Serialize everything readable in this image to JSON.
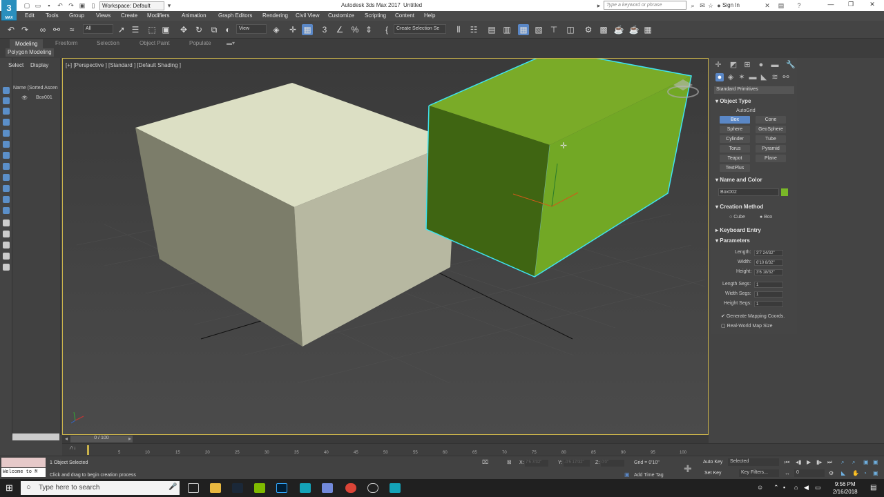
{
  "titlebar": {
    "workspace": "Workspace: Default",
    "app_title": "Autodesk 3ds Max 2017",
    "doc_title": "Untitled",
    "search_placeholder": "Type a keyword or phrase",
    "signin": "Sign In",
    "logo": "3",
    "logo_sub": "MAX"
  },
  "menu": [
    "Edit",
    "Tools",
    "Group",
    "Views",
    "Create",
    "Modifiers",
    "Animation",
    "Graph Editors",
    "Rendering",
    "Civil View",
    "Customize",
    "Scripting",
    "Content",
    "Help"
  ],
  "toolbar": {
    "filter": "All",
    "view": "View",
    "selection_set": "Create Selection Se"
  },
  "ribbon": {
    "tabs": [
      "Modeling",
      "Freeform",
      "Selection",
      "Object Paint",
      "Populate"
    ],
    "polygon_modeling": "Polygon Modeling"
  },
  "scene_explorer": {
    "tab_select": "Select",
    "tab_display": "Display",
    "header": "Name (Sorted Ascen",
    "object": "Box001"
  },
  "viewport": {
    "label": "[+] [Perspective ] [Standard ] [Default Shading ]",
    "box1_color": "#dcdfc4",
    "box2_color": "#7aab28",
    "selection_color": "#3fe3f0"
  },
  "command_panel": {
    "dropdown": "Standard Primitives",
    "object_type": {
      "title": "Object Type",
      "autogrid": "AutoGrid",
      "buttons": [
        "Box",
        "Cone",
        "Sphere",
        "GeoSphere",
        "Cylinder",
        "Tube",
        "Torus",
        "Pyramid",
        "Teapot",
        "Plane",
        "TextPlus"
      ],
      "selected": "Box"
    },
    "name_color": {
      "title": "Name and Color",
      "name": "Box002",
      "color": "#7ab828"
    },
    "creation_method": {
      "title": "Creation Method",
      "cube": "Cube",
      "box": "Box"
    },
    "keyboard_entry": "Keyboard Entry",
    "parameters": {
      "title": "Parameters",
      "length_label": "Length:",
      "length": "3'7 24/32\"",
      "width_label": "Width:",
      "width": "6'10 8/32\"",
      "height_label": "Height:",
      "height": "3'6 18/32\"",
      "length_segs_label": "Length Segs:",
      "length_segs": "1",
      "width_segs_label": "Width Segs:",
      "width_segs": "1",
      "height_segs_label": "Height Segs:",
      "height_segs": "1",
      "gen_mapping": "Generate Mapping Coords.",
      "real_world": "Real-World Map Size"
    }
  },
  "timeline": {
    "frame": "0 / 100",
    "ticks": [
      "5",
      "10",
      "15",
      "20",
      "25",
      "30",
      "35",
      "40",
      "45",
      "50",
      "55",
      "60",
      "65",
      "70",
      "75",
      "80",
      "85",
      "90",
      "95",
      "100"
    ]
  },
  "status": {
    "selected": "1 Object Selected",
    "prompt": "Click and drag to begin creation process",
    "maxscript": "Welcome to M",
    "x_label": "X:",
    "x": "7'5 7/32\"",
    "y_label": "Y:",
    "y": "-0'5 17/32\"",
    "z_label": "Z:",
    "z": "0'0\"",
    "grid": "Grid = 0'10\"",
    "add_time_tag": "Add Time Tag",
    "auto_key": "Auto Key",
    "set_key": "Set Key",
    "selected_dd": "Selected",
    "key_filters": "Key Filters...",
    "frame_field": "0"
  },
  "taskbar": {
    "search": "Type here to search",
    "time": "9:56 PM",
    "date": "2/16/2018"
  }
}
